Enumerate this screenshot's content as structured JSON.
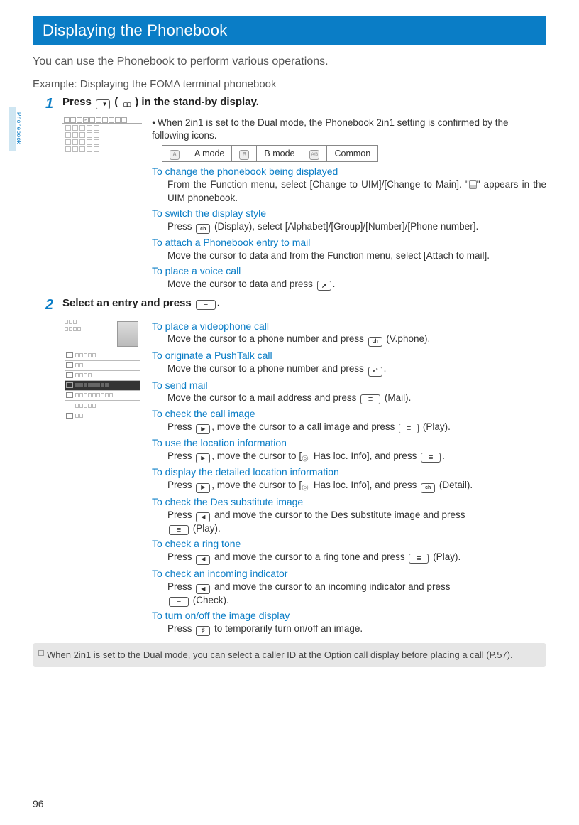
{
  "sidebar": {
    "label": "Phonebook"
  },
  "banner": "Displaying the Phonebook",
  "intro": "You can use the Phonebook to perform various operations.",
  "example": "Example: Displaying the FOMA terminal phonebook",
  "page_number": "96",
  "step1": {
    "num": "1",
    "head_before": "Press ",
    "head_paren": " (",
    "head_after": ") in the stand-by display.",
    "bullet": "When 2in1 is set to the Dual mode, the Phonebook 2in1 setting is confirmed by the following icons.",
    "modes": {
      "a": "A mode",
      "b": "B mode",
      "c": "Common",
      "a_ic": "A",
      "b_ic": "B",
      "c_ic": "A/B"
    },
    "items": [
      {
        "title": "To change the phonebook being displayed",
        "body_before": "From the Function menu, select [Change to UIM]/[Change to Main]. \"",
        "body_after": "\" appears in the UIM phonebook."
      },
      {
        "title": "To switch the display style",
        "body_before": "Press ",
        "key_label": " (Display), select [Alphabet]/[Group]/[Number]/[Phone number].",
        "key": "ch"
      },
      {
        "title": "To attach a Phonebook entry to mail",
        "body": "Move the cursor to data and from the Function menu, select [Attach to mail]."
      },
      {
        "title": "To place a voice call",
        "body_before": "Move the cursor to data and press ",
        "body_after": ".",
        "key": "call"
      }
    ]
  },
  "step2": {
    "num": "2",
    "head_before": "Select an entry and press ",
    "head_after": ".",
    "items": [
      {
        "title": "To place a videophone call",
        "body": "Move the cursor to a phone number and press ",
        "key": "ch",
        "after": " (V.phone)."
      },
      {
        "title": "To originate a PushTalk call",
        "body": "Move the cursor to a phone number and press ",
        "key": "ptt",
        "after": "."
      },
      {
        "title": "To send mail",
        "body": "Move the cursor to a mail address and press ",
        "key": "menu",
        "after": " (Mail)."
      },
      {
        "title": "To check the call image",
        "body": "Press ",
        "key": "r",
        "mid": ", move the cursor to a call image and press ",
        "key2": "menu",
        "after": " (Play)."
      },
      {
        "title": "To use the location information",
        "body": "Press ",
        "key": "r",
        "mid": ", move the cursor to [",
        "loc": true,
        "loc_txt": " Has loc. Info], and press ",
        "key2": "menu",
        "after": "."
      },
      {
        "title": "To display the detailed location information",
        "body": "Press ",
        "key": "r",
        "mid": ", move the cursor to [",
        "loc": true,
        "loc_txt": " Has loc. Info], and press ",
        "key2": "ch",
        "after": " (Detail)."
      },
      {
        "title": "To check the Des substitute image",
        "body": "Press ",
        "key": "l",
        "mid": " and move the cursor to the Des substitute image and press ",
        "key2": "menu",
        "after": " (Play).",
        "wrap_key2": true
      },
      {
        "title": "To check a ring tone",
        "body": "Press ",
        "key": "l",
        "mid": " and move the cursor to a ring tone and press ",
        "key2": "menu",
        "after": " (Play)."
      },
      {
        "title": "To check an incoming indicator",
        "body": "Press ",
        "key": "l",
        "mid": " and move the cursor to an incoming indicator and press ",
        "key2": "menu",
        "after": " (Check).",
        "wrap_key2": true
      },
      {
        "title": "To turn on/off the image display",
        "body": "Press ",
        "key": "hash",
        "after": " to temporarily turn on/off an image."
      }
    ]
  },
  "note": "When 2in1 is set to the Dual mode, you can select a caller ID at the Option call display before placing a call (P.57)."
}
